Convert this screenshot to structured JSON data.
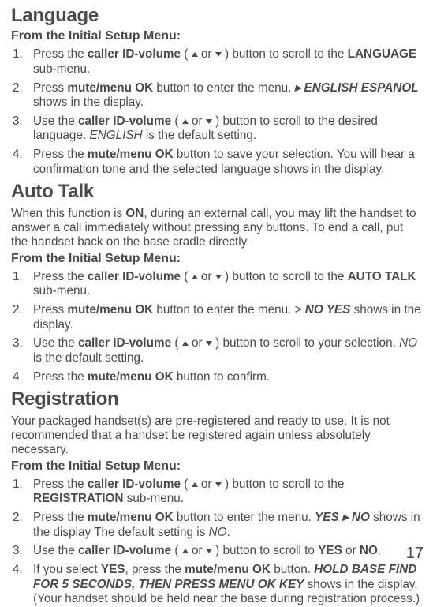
{
  "page_number": "17",
  "lang": {
    "heading": "Language",
    "subhead": "From the Initial Setup Menu:",
    "steps": [
      {
        "pre": "Press the ",
        "b1": "caller ID-volume",
        "mid": " ( ",
        "or": " or  ",
        "post1": " ) button to scroll to the ",
        "b2": "LANGUAGE",
        "post2": " sub-menu."
      },
      {
        "pre": "Press ",
        "b1": "mute/menu OK",
        "mid": " button to enter the menu.  ",
        "sym": "▸",
        "b2": " ENGLISH ESPANOL",
        "post": " shows in the display."
      },
      {
        "pre": "Use the ",
        "b1": "caller ID-volume",
        "mid": " ( ",
        "or": " or  ",
        "post1": " ) button to scroll to the desired language. ",
        "i": "ENGLISH",
        "post2": " is the default setting."
      },
      {
        "pre": "Press the ",
        "b1": "mute/menu OK",
        "post": " button to save your selection. You will hear a confirmation tone and the selected language shows in the display."
      }
    ]
  },
  "auto": {
    "heading": "Auto Talk",
    "intro_pre": "When this function is ",
    "intro_on": "ON",
    "intro_post": ", during an external call, you may lift the handset to answer a call immediately without pressing any buttons. To end a call, put the handset back on the base cradle directly.",
    "subhead": "From the Initial Setup Menu:",
    "steps": [
      {
        "pre": "Press the ",
        "b1": "caller ID-volume",
        "mid": " ( ",
        "or": " or  ",
        "post1": " ) button to scroll to the ",
        "b2": "AUTO TALK",
        "post2": " sub-menu."
      },
      {
        "pre": "Press ",
        "b1": "mute/menu OK",
        "mid": " button to enter the menu.  > ",
        "b2": "NO YES",
        "post": " shows in the display."
      },
      {
        "pre": "Use the ",
        "b1": "caller ID-volume",
        "mid": " ( ",
        "or": " or  ",
        "post1": " ) button to scroll to your selection.  ",
        "i": "NO",
        "post2": " is the default setting."
      },
      {
        "pre": "Press the ",
        "b1": "mute/menu OK",
        "post": " button to confirm."
      }
    ]
  },
  "reg": {
    "heading": "Registration",
    "intro": "Your packaged handset(s) are pre-registered and ready to use. It is not recommended that a handset be registered again unless absolutely necessary.",
    "subhead": "From the Initial Setup Menu:",
    "steps": [
      {
        "pre": "Press the ",
        "b1": "caller ID-volume",
        "mid": " ( ",
        "or": " or  ",
        "post1": " ) button to scroll to the ",
        "b2": "REGISTRATION",
        "post2": " sub-menu."
      },
      {
        "pre": "Press the ",
        "b1": "mute/menu OK",
        "mid": " button to enter the menu. ",
        "b2": "YES ",
        "sym": "▸",
        "b3": " NO",
        "post1": " shows in the display The default setting is ",
        "i": "NO",
        "post2": "."
      },
      {
        "pre": "Use the ",
        "b1": "caller ID-volume",
        "mid": " ( ",
        "or": " or  ",
        "post1": " ) button to scroll to ",
        "b2": "YES",
        "mid2": " or ",
        "b3": "NO",
        "post2": "."
      },
      {
        "pre": "If you select ",
        "b1": "YES",
        "mid": ", press the ",
        "b2": "mute/menu OK",
        "mid2": " button. ",
        "b3": "HOLD BASE FIND FOR 5 SECONDS, THEN PRESS MENU OK KEY",
        "post": " shows in the display. (Your handset should be held near the base during registration process.)"
      }
    ]
  }
}
